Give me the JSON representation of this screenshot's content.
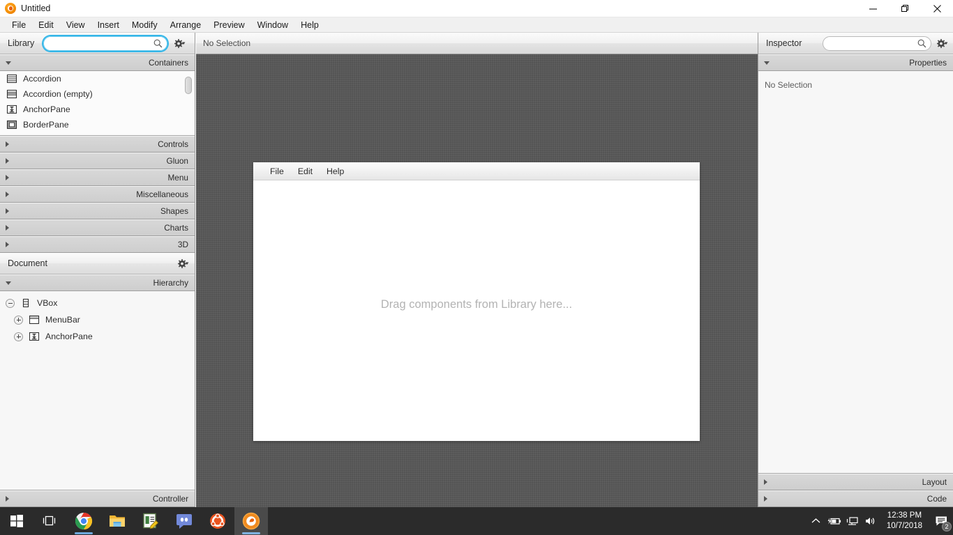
{
  "window": {
    "title": "Untitled",
    "app_icon": "scenebuilder-icon",
    "controls": {
      "minimize": "minimize-icon",
      "maximize": "maximize-icon",
      "close": "close-icon"
    }
  },
  "menubar": {
    "items": [
      "File",
      "Edit",
      "View",
      "Insert",
      "Modify",
      "Arrange",
      "Preview",
      "Window",
      "Help"
    ]
  },
  "library": {
    "title": "Library",
    "search_value": "",
    "search_placeholder": "",
    "gear_label": "gear-icon",
    "sections": [
      {
        "label": "Containers",
        "expanded": true
      },
      {
        "label": "Controls",
        "expanded": false
      },
      {
        "label": "Gluon",
        "expanded": false
      },
      {
        "label": "Menu",
        "expanded": false
      },
      {
        "label": "Miscellaneous",
        "expanded": false
      },
      {
        "label": "Shapes",
        "expanded": false
      },
      {
        "label": "Charts",
        "expanded": false
      },
      {
        "label": "3D",
        "expanded": false
      }
    ],
    "containers_items": [
      {
        "label": "Accordion",
        "icon": "accordion-icon"
      },
      {
        "label": "Accordion  (empty)",
        "icon": "accordion-empty-icon"
      },
      {
        "label": "AnchorPane",
        "icon": "anchorpane-icon"
      },
      {
        "label": "BorderPane",
        "icon": "borderpane-icon"
      }
    ]
  },
  "document": {
    "title": "Document",
    "gear_label": "gear-icon",
    "hierarchy_label": "Hierarchy",
    "controller_label": "Controller",
    "tree": [
      {
        "label": "VBox",
        "icon": "vbox-icon",
        "indent": 0,
        "expander": "minus"
      },
      {
        "label": "MenuBar",
        "icon": "menubar-icon",
        "indent": 1,
        "expander": "plus"
      },
      {
        "label": "AnchorPane",
        "icon": "anchorpane-icon",
        "indent": 1,
        "expander": "plus"
      }
    ]
  },
  "content": {
    "selection_status": "No Selection",
    "stage": {
      "menu_items": [
        "File",
        "Edit",
        "Help"
      ],
      "placeholder": "Drag components from Library here..."
    }
  },
  "inspector": {
    "title": "Inspector",
    "search_value": "",
    "search_placeholder": "",
    "gear_label": "gear-icon",
    "properties_label": "Properties",
    "no_selection": "No Selection",
    "layout_label": "Layout",
    "code_label": "Code"
  },
  "taskbar": {
    "items": [
      {
        "name": "start-button",
        "icon": "windows-logo-icon"
      },
      {
        "name": "task-view-button",
        "icon": "task-view-icon"
      },
      {
        "name": "chrome-button",
        "icon": "chrome-icon",
        "running": true
      },
      {
        "name": "file-explorer-button",
        "icon": "folder-icon"
      },
      {
        "name": "editor-button",
        "icon": "notepad-edit-icon"
      },
      {
        "name": "discord-button",
        "icon": "discord-icon"
      },
      {
        "name": "ubuntu-button",
        "icon": "ubuntu-icon"
      },
      {
        "name": "scenebuilder-button",
        "icon": "scenebuilder-icon",
        "active": true
      }
    ],
    "tray": {
      "chevron": "chevron-up-icon",
      "battery": "battery-charging-icon",
      "network": "network-icon",
      "volume": "volume-icon"
    },
    "clock": {
      "time": "12:38 PM",
      "date": "10/7/2018"
    },
    "notifications": {
      "icon": "action-center-icon",
      "count": "2"
    }
  },
  "colors": {
    "accent_focus": "#35b6e8",
    "canvas_bg": "#545454",
    "panel_bg": "#f5f5f5",
    "taskbar_bg": "#2b2b2b"
  }
}
